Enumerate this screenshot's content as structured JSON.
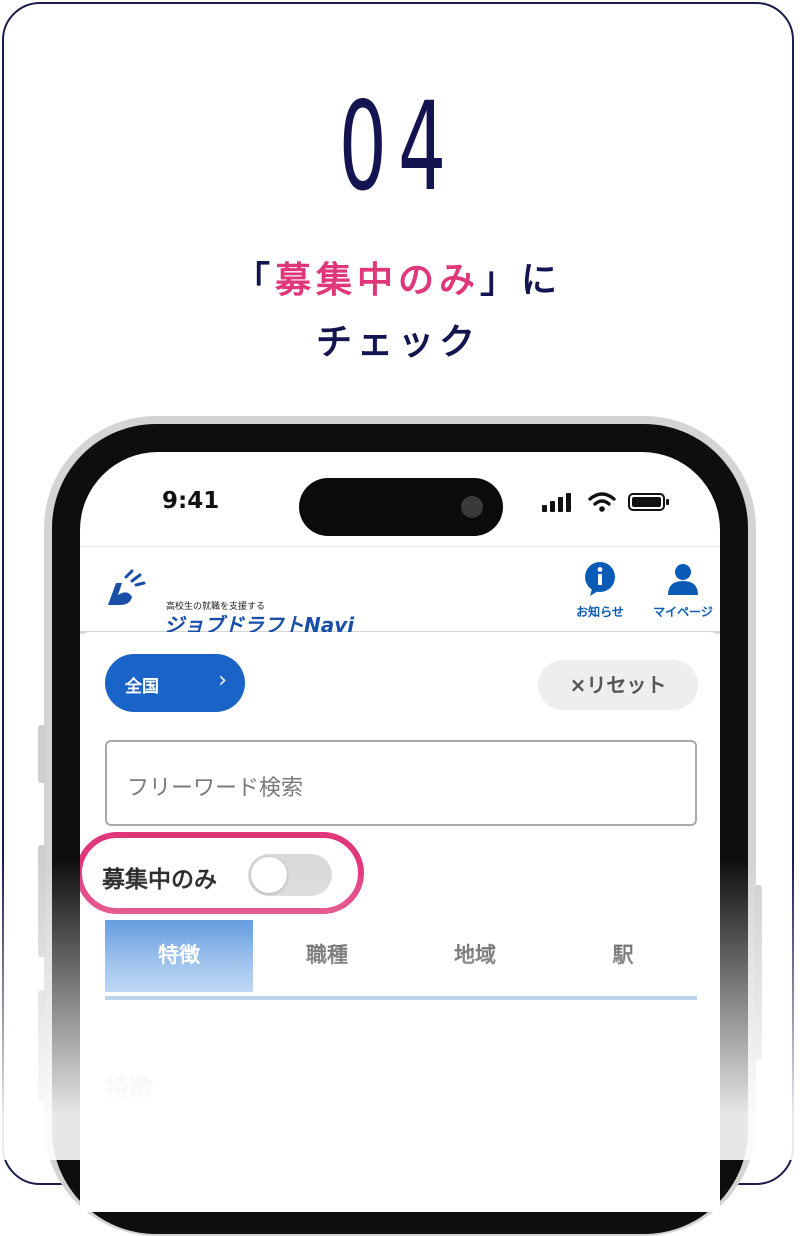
{
  "step": {
    "number": "04"
  },
  "headline": {
    "open_bracket": "「",
    "highlight": "募集中のみ",
    "close": "」に",
    "line2": "チェック"
  },
  "colors": {
    "navy": "#141450",
    "accent_pink": "#e0367a",
    "brand_blue": "#1a63c7"
  },
  "status_bar": {
    "time": "9:41"
  },
  "app_header": {
    "logo_tagline": "高校生の就職を支援する",
    "logo_name": "ジョブドラフトNavi",
    "notices_label": "お知らせ",
    "mypage_label": "マイページ"
  },
  "filters": {
    "region_label": "全国",
    "reset_label": "×リセット",
    "search_placeholder": "フリーワード検索",
    "toggle_label": "募集中のみ",
    "toggle_on": false
  },
  "tabs": [
    {
      "label": "特徴",
      "active": true
    },
    {
      "label": "職種",
      "active": false
    },
    {
      "label": "地域",
      "active": false
    },
    {
      "label": "駅",
      "active": false
    }
  ],
  "section_title": "特徴"
}
